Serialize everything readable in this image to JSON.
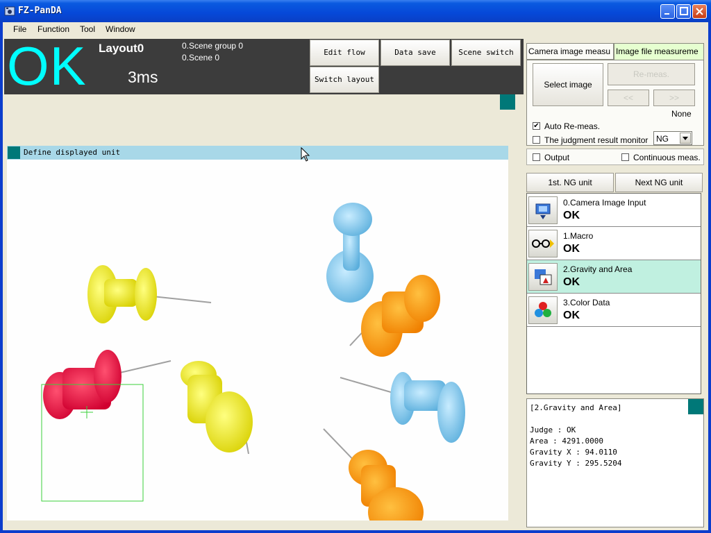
{
  "window": {
    "title": "FZ-PanDA"
  },
  "menu": [
    "File",
    "Function",
    "Tool",
    "Window"
  ],
  "status": {
    "judge": "OK",
    "layout": "Layout0",
    "time": "3ms",
    "scene_group": "0.Scene group 0",
    "scene": "0.Scene 0",
    "judge_color": "#00ffff"
  },
  "toolbar": {
    "edit_flow": "Edit flow",
    "data_save": "Data save",
    "scene_switch": "Scene switch",
    "switch_layout": "Switch layout"
  },
  "image_panel": {
    "label": "Define displayed unit"
  },
  "measure_tabs": {
    "camera": "Camera image measu",
    "image_file": "Image file measureme",
    "select_image": "Select image",
    "re_meas": "Re-meas.",
    "prev": "<<",
    "next": ">>",
    "file_name": "None",
    "auto_remeas": "Auto Re-meas.",
    "judgment_monitor": "The judgment result monitor",
    "judgment_value": "NG"
  },
  "output_row": {
    "output": "Output",
    "continuous": "Continuous meas."
  },
  "ng_nav": {
    "first": "1st. NG unit",
    "next": "Next NG unit"
  },
  "units": [
    {
      "name": "0.Camera Image Input",
      "result": "OK",
      "icon": "camera-icon"
    },
    {
      "name": "1.Macro",
      "result": "OK",
      "icon": "macro-icon"
    },
    {
      "name": "2.Gravity and Area",
      "result": "OK",
      "icon": "gravity-area-icon"
    },
    {
      "name": "3.Color Data",
      "result": "OK",
      "icon": "color-data-icon"
    }
  ],
  "detail": {
    "header": "[2.Gravity and Area]",
    "judge": "Judge : OK",
    "area": "Area : 4291.0000",
    "gx": "Gravity X : 94.0110",
    "gy": "Gravity Y : 295.5204"
  }
}
